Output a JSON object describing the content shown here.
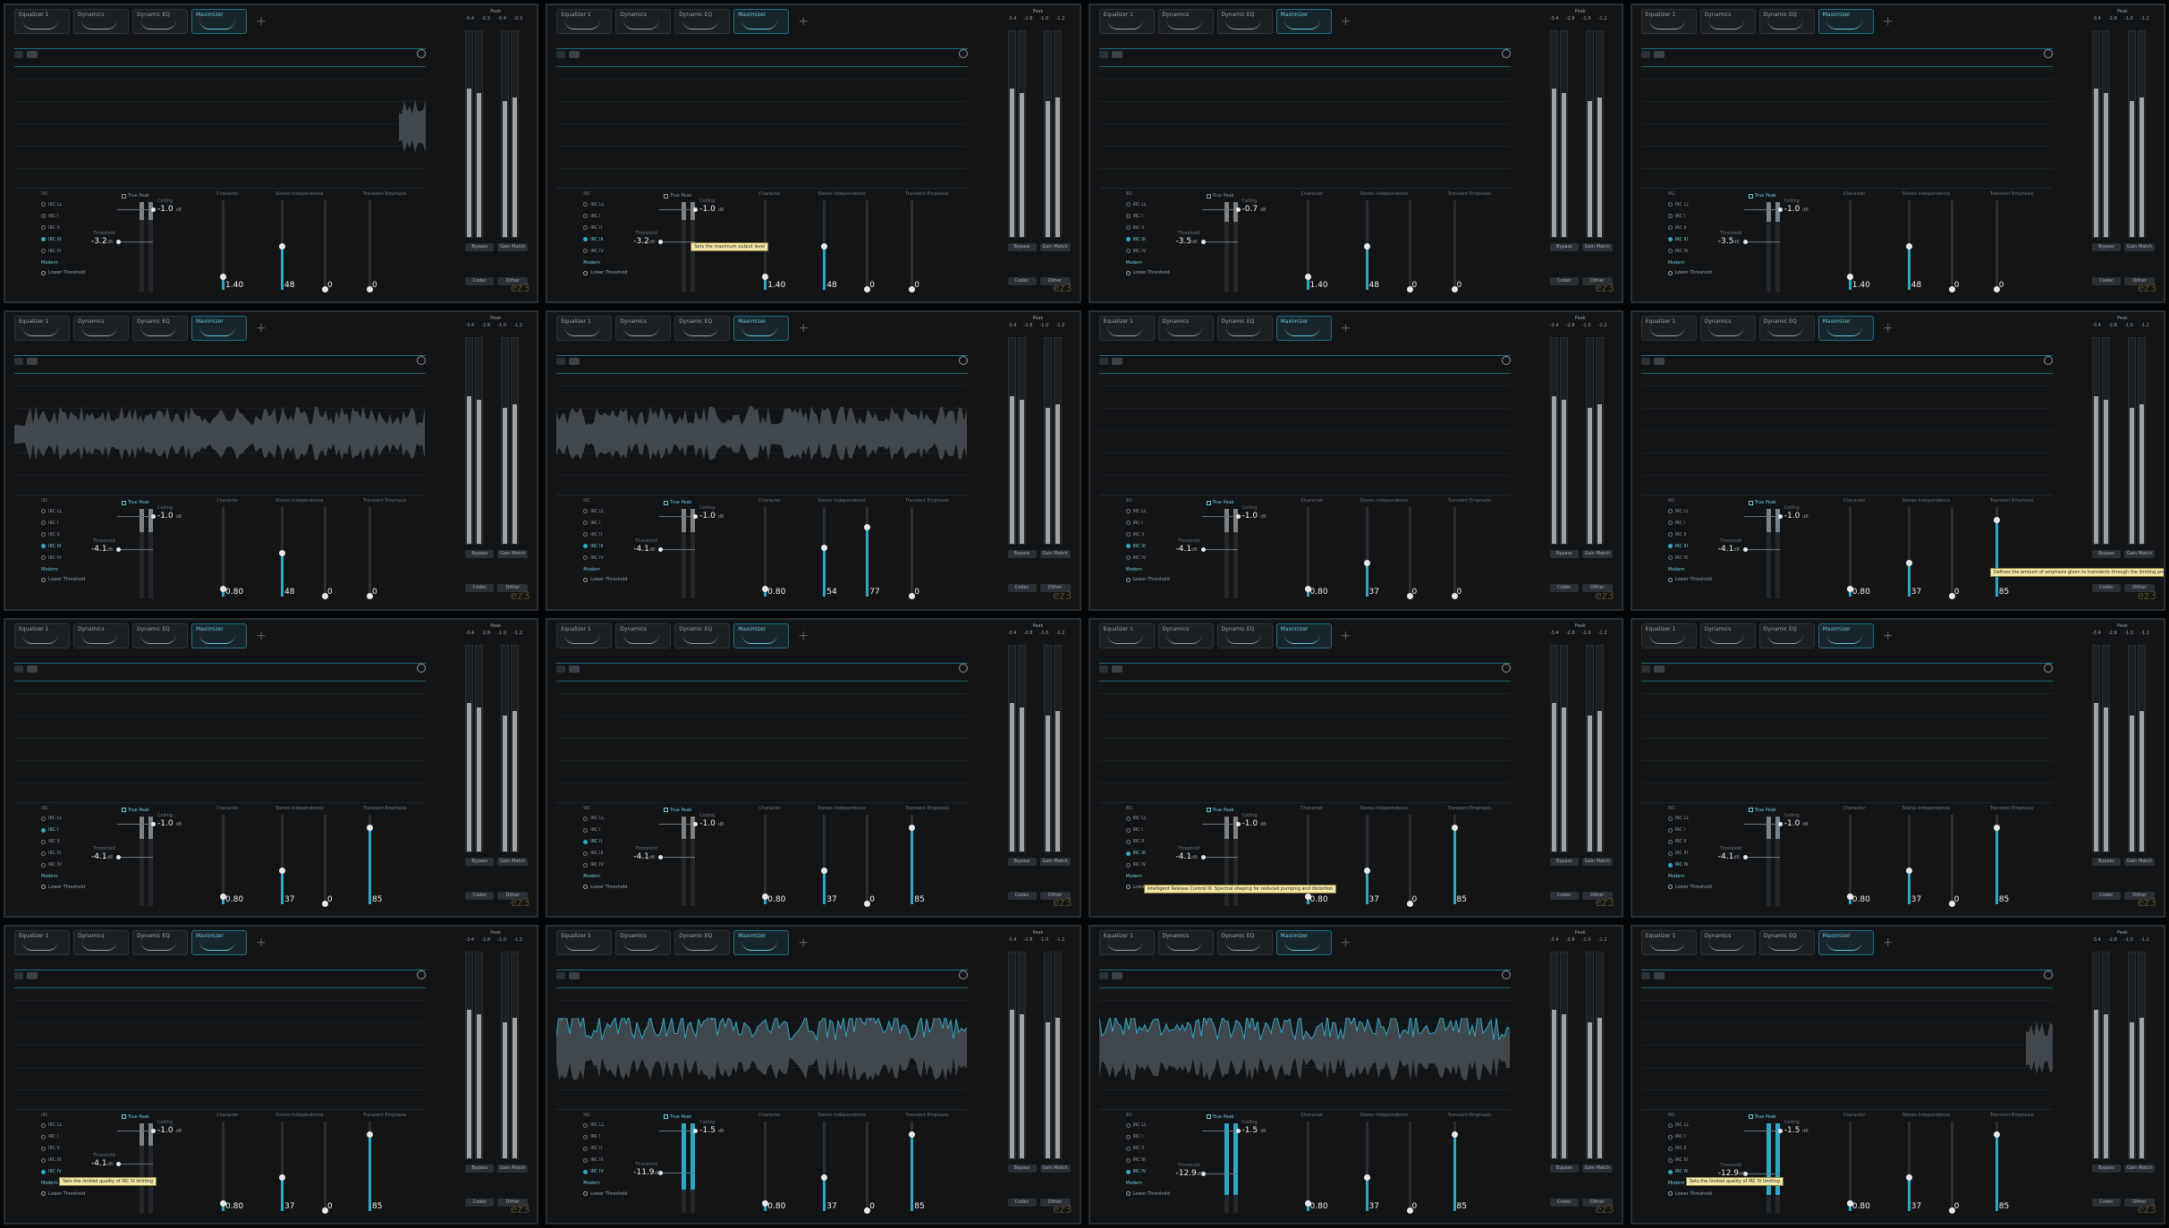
{
  "app": {
    "tabs": [
      "Equalizer 1",
      "Dynamics",
      "Dynamic EQ",
      "Maximizer"
    ],
    "active_tab": "Maximizer",
    "add_tab": "+",
    "watermark": "ez3"
  },
  "maximizer": {
    "mode_label": "IRC",
    "modes": [
      "IRC LL",
      "IRC I",
      "IRC II",
      "IRC III",
      "IRC IV"
    ],
    "style_label": "Modern",
    "low_latency": "Lower Threshold",
    "true_peak": "True Peak",
    "threshold_label": "Threshold",
    "ceiling_label": "Ceiling",
    "ceiling_unit": "dB",
    "character_label": "Character",
    "stereo_independence_label": "Stereo Independence",
    "transient_label": "Transient Emphasis",
    "transient_amount_label": "Amount",
    "transient_label_2": "Emphasis",
    "meter_buttons": [
      "Bypass",
      "Gain Match",
      "Codec",
      "Dither"
    ],
    "meter_headers": [
      "Peak",
      "RMS"
    ]
  },
  "tiles": [
    {
      "threshold": "-3.2",
      "ceiling": "-1.0",
      "character": "1.40",
      "transient": "48",
      "stereo": "0",
      "amount": "0",
      "mode": 3,
      "true_peak": false,
      "wave": "tail",
      "tooltip": "",
      "meter_top": [
        "-0.4",
        "-0.3",
        "-0.4",
        "-0.3"
      ]
    },
    {
      "threshold": "-3.2",
      "ceiling": "-1.0",
      "character": "1.40",
      "transient": "48",
      "stereo": "0",
      "amount": "0",
      "mode": 3,
      "true_peak": false,
      "wave": "none",
      "tooltip": "Sets the maximum output level",
      "meter_top": [
        "-3.4",
        "-2.8",
        "-1.0",
        "-1.2"
      ]
    },
    {
      "threshold": "-3.5",
      "ceiling": "-0.7",
      "character": "1.40",
      "transient": "48",
      "stereo": "0",
      "amount": "0",
      "mode": 3,
      "true_peak": false,
      "wave": "none",
      "tooltip": "",
      "meter_top": [
        "-3.4",
        "-2.8",
        "-1.0",
        "-1.2"
      ]
    },
    {
      "threshold": "-3.5",
      "ceiling": "-1.0",
      "character": "1.40",
      "transient": "48",
      "stereo": "0",
      "amount": "0",
      "mode": 3,
      "true_peak": true,
      "wave": "none",
      "tooltip": "",
      "meter_top": [
        "-3.4",
        "-2.8",
        "-1.0",
        "-1.2"
      ]
    },
    {
      "threshold": "-4.1",
      "ceiling": "-1.0",
      "character": "0.80",
      "transient": "48",
      "stereo": "0",
      "amount": "0",
      "mode": 3,
      "true_peak": true,
      "wave": "full",
      "tooltip": "",
      "meter_top": [
        "-3.4",
        "-2.8",
        "-1.0",
        "-1.2"
      ]
    },
    {
      "threshold": "-4.1",
      "ceiling": "-1.0",
      "character": "0.80",
      "transient": "54",
      "stereo": "77",
      "amount": "0",
      "mode": 3,
      "true_peak": true,
      "wave": "full",
      "tooltip": "",
      "meter_top": [
        "-3.4",
        "-2.8",
        "-1.0",
        "-1.2"
      ]
    },
    {
      "threshold": "-4.1",
      "ceiling": "-1.0",
      "character": "0.80",
      "transient": "37",
      "stereo": "0",
      "amount": "0",
      "mode": 3,
      "true_peak": true,
      "wave": "none",
      "tooltip": "",
      "meter_top": [
        "-3.4",
        "-2.8",
        "-1.0",
        "-1.2"
      ]
    },
    {
      "threshold": "-4.1",
      "ceiling": "-1.0",
      "character": "0.80",
      "transient": "37",
      "stereo": "0",
      "amount": "85",
      "mode": 3,
      "true_peak": true,
      "wave": "none",
      "tooltip": "Defines the amount of emphasis given to transients through the limiting process",
      "meter_top": [
        "-3.4",
        "-2.8",
        "-1.0",
        "-1.2"
      ]
    },
    {
      "threshold": "-4.1",
      "ceiling": "-1.0",
      "character": "0.80",
      "transient": "37",
      "stereo": "0",
      "amount": "85",
      "mode": 1,
      "true_peak": true,
      "wave": "none",
      "tooltip": "",
      "meter_top": [
        "-3.4",
        "-2.8",
        "-1.0",
        "-1.2"
      ]
    },
    {
      "threshold": "-4.1",
      "ceiling": "-1.0",
      "character": "0.80",
      "transient": "37",
      "stereo": "0",
      "amount": "85",
      "mode": 2,
      "true_peak": true,
      "wave": "none",
      "tooltip": "",
      "meter_top": [
        "-3.4",
        "-2.8",
        "-1.0",
        "-1.2"
      ]
    },
    {
      "threshold": "-4.1",
      "ceiling": "-1.0",
      "character": "0.80",
      "transient": "37",
      "stereo": "0",
      "amount": "85",
      "mode": 3,
      "true_peak": true,
      "wave": "none",
      "tooltip": "Intelligent Release Control III: Spectral shaping for reduced pumping and distortion",
      "meter_top": [
        "-3.4",
        "-2.8",
        "-1.0",
        "-1.2"
      ]
    },
    {
      "threshold": "-4.1",
      "ceiling": "-1.0",
      "character": "0.80",
      "transient": "37",
      "stereo": "0",
      "amount": "85",
      "mode": 4,
      "true_peak": true,
      "wave": "none",
      "tooltip": "",
      "meter_top": [
        "-3.4",
        "-2.8",
        "-1.0",
        "-1.2"
      ]
    },
    {
      "threshold": "-4.1",
      "ceiling": "-1.0",
      "character": "0.80",
      "transient": "37",
      "stereo": "0",
      "amount": "85",
      "mode": 4,
      "true_peak": true,
      "wave": "none",
      "tooltip": "Sets the limited quality of IRC IV limiting",
      "meter_top": [
        "-3.4",
        "-2.8",
        "-1.0",
        "-1.2"
      ]
    },
    {
      "threshold": "-11.9",
      "ceiling": "-1.5",
      "character": "0.80",
      "transient": "37",
      "stereo": "0",
      "amount": "85",
      "mode": 4,
      "true_peak": true,
      "wave": "cyan",
      "tooltip": "",
      "meter_top": [
        "-3.4",
        "-2.8",
        "-1.0",
        "-1.2"
      ]
    },
    {
      "threshold": "-12.9",
      "ceiling": "-1.5",
      "character": "0.80",
      "transient": "37",
      "stereo": "0",
      "amount": "85",
      "mode": 4,
      "true_peak": true,
      "wave": "cyan",
      "tooltip": "",
      "meter_top": [
        "-3.4",
        "-2.8",
        "-1.0",
        "-1.2"
      ]
    },
    {
      "threshold": "-12.9",
      "ceiling": "-1.5",
      "character": "0.80",
      "transient": "37",
      "stereo": "0",
      "amount": "85",
      "mode": 4,
      "true_peak": true,
      "wave": "tail",
      "tooltip": "Sets the limited quality of IRC IV limiting",
      "meter_top": [
        "-3.4",
        "-2.8",
        "-1.0",
        "-1.2"
      ]
    }
  ]
}
